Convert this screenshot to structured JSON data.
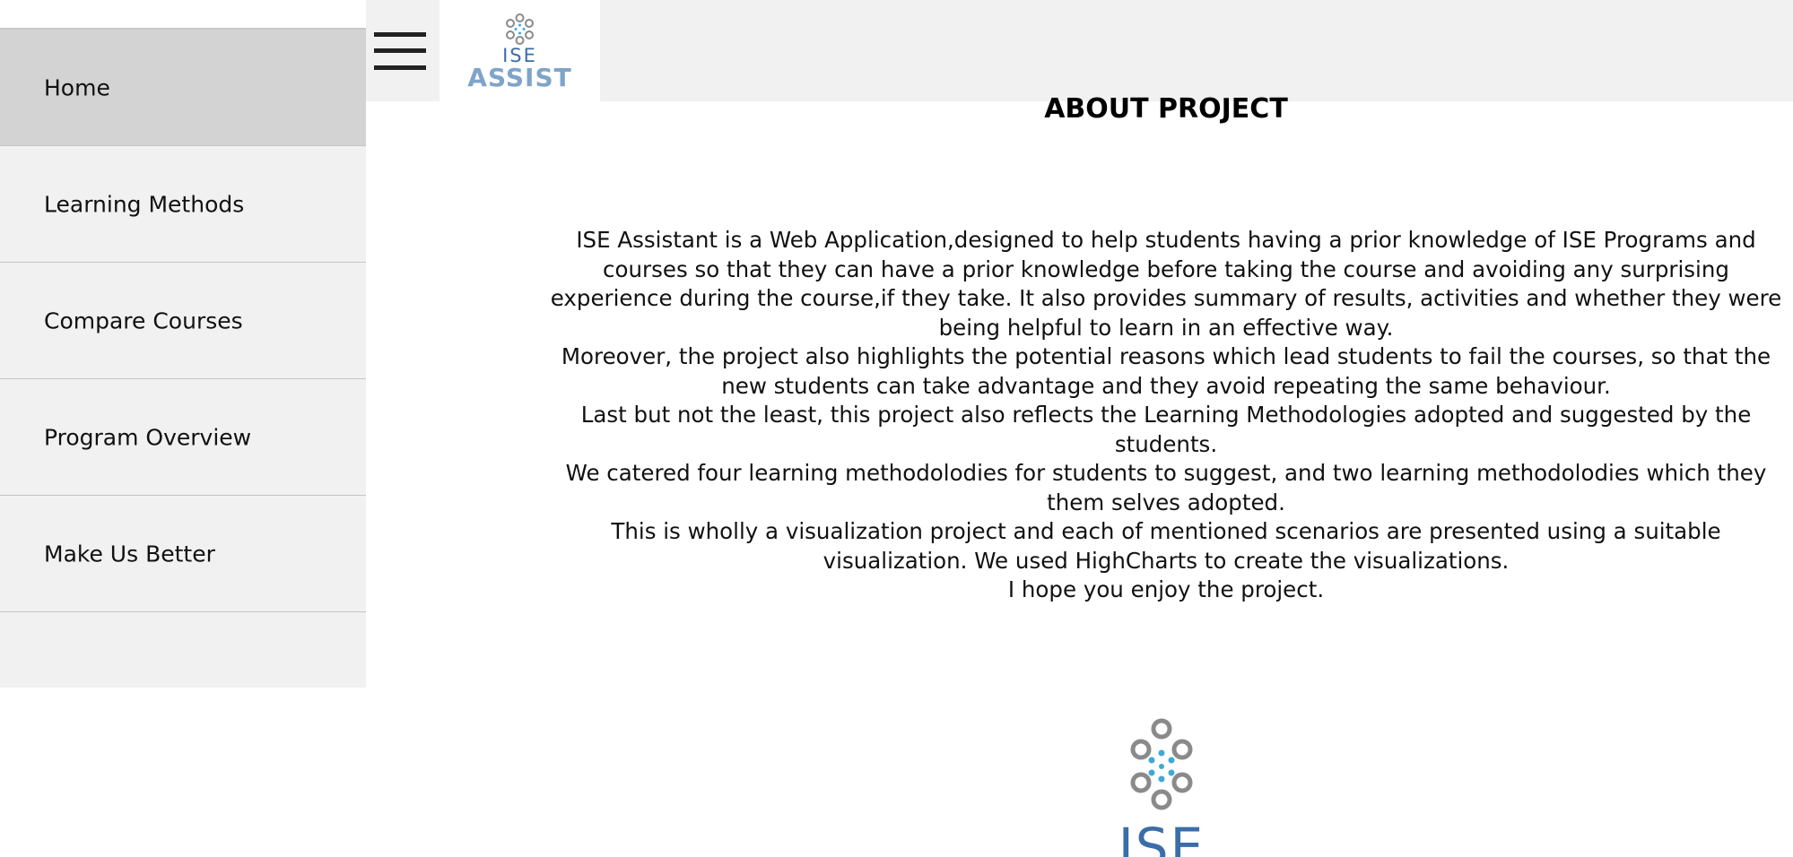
{
  "sidebar": {
    "items": [
      {
        "label": "Home",
        "active": true
      },
      {
        "label": "Learning Methods",
        "active": false
      },
      {
        "label": "Compare Courses",
        "active": false
      },
      {
        "label": "Program Overview",
        "active": false
      },
      {
        "label": "Make Us Better",
        "active": false
      }
    ]
  },
  "header": {
    "menu_icon": "hamburger-icon",
    "logo_line1": "ISE",
    "logo_line2": "ASSIST"
  },
  "main": {
    "title": "ABOUT PROJECT",
    "paragraphs": [
      "ISE Assistant is a Web Application,designed to help students having a prior knowledge of ISE Programs and courses so that they can have a prior knowledge before taking the course and avoiding any surprising experience during the course,if they take. It also provides summary of results, activities and whether they were being helpful to learn in an effective way.",
      "Moreover, the project also highlights the potential reasons which lead students to fail the courses, so that the new students can take advantage and they avoid repeating the same behaviour.",
      "Last but not the least, this project also reflects the Learning Methodologies adopted and suggested by the students.",
      "We catered four learning methodolodies for students to suggest, and two learning methodolodies which they them selves adopted.",
      "This is wholly a visualization project and each of mentioned scenarios are presented using a suitable visualization. We used HighCharts to create the visualizations.",
      "I hope you enjoy the project."
    ],
    "footer_logo_text": "ISE"
  },
  "colors": {
    "sidebar_bg": "#f1f1f1",
    "active_bg": "#d3d3d3",
    "logo_blue": "#3b6da8",
    "logo_grey": "#8a8a8a",
    "logo_dot_blue": "#3fa8d8"
  }
}
